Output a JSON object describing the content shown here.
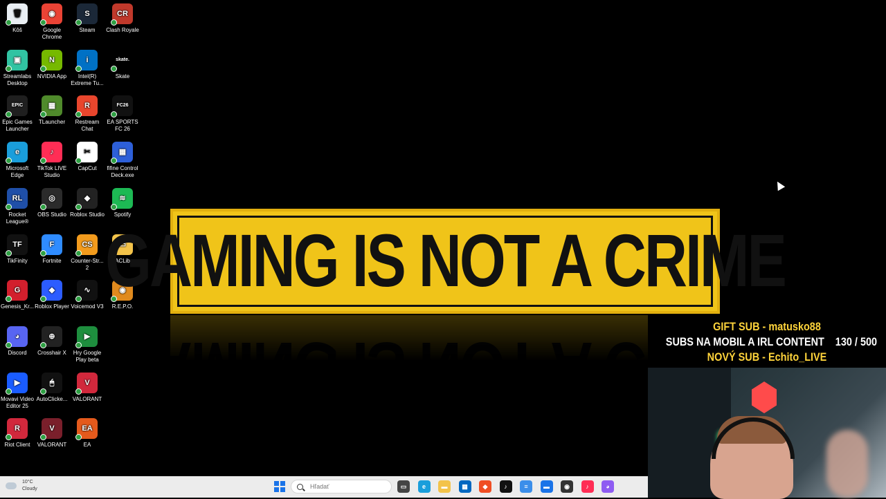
{
  "desktop": {
    "icons": [
      {
        "label": "Kôš",
        "color": "#e9eef3",
        "glyph": "🗑"
      },
      {
        "label": "Google Chrome",
        "color": "#ea4335",
        "glyph": "◉"
      },
      {
        "label": "Steam",
        "color": "#1b2838",
        "glyph": "S"
      },
      {
        "label": "Clash Royale",
        "color": "#c0392b",
        "glyph": "CR"
      },
      {
        "label": "Streamlabs Desktop",
        "color": "#31c3a2",
        "glyph": "▣"
      },
      {
        "label": "NVIDIA App",
        "color": "#76b900",
        "glyph": "N"
      },
      {
        "label": "Intel(R) Extreme Tu...",
        "color": "#0071c5",
        "glyph": "i"
      },
      {
        "label": "Skate",
        "color": "#000000",
        "glyph": "skate."
      },
      {
        "label": "Epic Games Launcher",
        "color": "#1f1f1f",
        "glyph": "EPIC"
      },
      {
        "label": "TLauncher",
        "color": "#4f8a2b",
        "glyph": "▦"
      },
      {
        "label": "Restream Chat",
        "color": "#e9462d",
        "glyph": "R"
      },
      {
        "label": "EA SPORTS FC 26",
        "color": "#111111",
        "glyph": "FC26"
      },
      {
        "label": "Microsoft Edge",
        "color": "#1a9edb",
        "glyph": "e"
      },
      {
        "label": "TikTok LIVE Studio",
        "color": "#ff2d55",
        "glyph": "♪"
      },
      {
        "label": "CapCut",
        "color": "#ffffff",
        "glyph": "✂"
      },
      {
        "label": "fifine Control Deck.exe",
        "color": "#2d5fd8",
        "glyph": "▦"
      },
      {
        "label": "Rocket League®",
        "color": "#1f4fa8",
        "glyph": "RL"
      },
      {
        "label": "OBS Studio",
        "color": "#2b2b2b",
        "glyph": "◎"
      },
      {
        "label": "Roblox Studio",
        "color": "#222222",
        "glyph": "◆"
      },
      {
        "label": "Spotify",
        "color": "#1db954",
        "glyph": "≋"
      },
      {
        "label": "TikFinity",
        "color": "#111111",
        "glyph": "TF"
      },
      {
        "label": "Fortnite",
        "color": "#2f8cff",
        "glyph": "F"
      },
      {
        "label": "Counter-Str... 2",
        "color": "#f29b1d",
        "glyph": "CS"
      },
      {
        "label": "ACLib",
        "color": "#f3c34a",
        "glyph": "▭"
      },
      {
        "label": "Genesis_Kr...",
        "color": "#d21f2d",
        "glyph": "G"
      },
      {
        "label": "Roblox Player",
        "color": "#2c5cff",
        "glyph": "◆"
      },
      {
        "label": "Voicemod V3",
        "color": "#111111",
        "glyph": "∿"
      },
      {
        "label": "R.E.P.O.",
        "color": "#e08a1e",
        "glyph": "◉"
      },
      {
        "label": "Discord",
        "color": "#5865f2",
        "glyph": "◕"
      },
      {
        "label": "Crosshair X",
        "color": "#222222",
        "glyph": "⊕"
      },
      {
        "label": "Hry Google Play beta",
        "color": "#1e8e3e",
        "glyph": "▶"
      },
      {
        "label": "",
        "color": "#000000",
        "glyph": ""
      },
      {
        "label": "Movavi Video Editor 25",
        "color": "#1a5cff",
        "glyph": "▶"
      },
      {
        "label": "AutoClicke...",
        "color": "#111111",
        "glyph": "🖱"
      },
      {
        "label": "VALORANT",
        "color": "#d1283c",
        "glyph": "V"
      },
      {
        "label": "",
        "color": "#000000",
        "glyph": ""
      },
      {
        "label": "Riot Client",
        "color": "#d1283c",
        "glyph": "R"
      },
      {
        "label": "VALORANT",
        "color": "#7a1f2b",
        "glyph": "V"
      },
      {
        "label": "EA",
        "color": "#e45a1c",
        "glyph": "EA"
      }
    ]
  },
  "wallpaper": {
    "banner_text": "GAMING IS NOT A CRIME"
  },
  "stream_overlay": {
    "gift_sub": "GIFT SUB - matusko88",
    "goal_text": "SUBS NA MOBIL A IRL CONTENT",
    "goal_progress": "130 / 500",
    "new_sub": "NOVÝ SUB - Echito_LIVE"
  },
  "taskbar": {
    "weather_temp": "10°C",
    "weather_desc": "Cloudy",
    "search_placeholder": "Hľadať",
    "apps": [
      {
        "name": "task-view",
        "color": "#444444",
        "glyph": "▭"
      },
      {
        "name": "edge",
        "color": "#1a9edb",
        "glyph": "e"
      },
      {
        "name": "file-explorer",
        "color": "#f3c34a",
        "glyph": "▬"
      },
      {
        "name": "store",
        "color": "#0067c0",
        "glyph": "▦"
      },
      {
        "name": "app-red",
        "color": "#f04e23",
        "glyph": "◆"
      },
      {
        "name": "tiktok",
        "color": "#111111",
        "glyph": "♪"
      },
      {
        "name": "notepad",
        "color": "#3b8eea",
        "glyph": "≡"
      },
      {
        "name": "monitor",
        "color": "#1a73e8",
        "glyph": "▬"
      },
      {
        "name": "app-dark",
        "color": "#333333",
        "glyph": "◉"
      },
      {
        "name": "tiktok-live",
        "color": "#ff2d55",
        "glyph": "♪"
      },
      {
        "name": "discord-like",
        "color": "#8e5cf2",
        "glyph": "◕"
      }
    ]
  }
}
